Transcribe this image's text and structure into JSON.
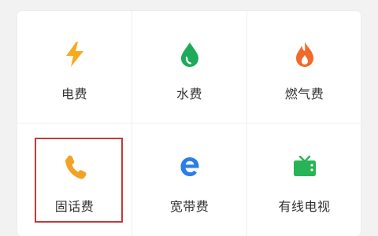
{
  "tiles": [
    {
      "label": "电费",
      "icon": "lightning-icon",
      "color": "#f6ab1f"
    },
    {
      "label": "水费",
      "icon": "water-drop-icon",
      "color": "#1eaa5b"
    },
    {
      "label": "燃气费",
      "icon": "flame-icon",
      "color": "#f16a2b"
    },
    {
      "label": "固话费",
      "icon": "phone-icon",
      "color": "#f2a224"
    },
    {
      "label": "宽带费",
      "icon": "broadband-e-icon",
      "color": "#2b7ee8"
    },
    {
      "label": "有线电视",
      "icon": "tv-icon",
      "color": "#27b356"
    }
  ],
  "highlight": {
    "target": "固话费",
    "color": "#c13b3b"
  }
}
